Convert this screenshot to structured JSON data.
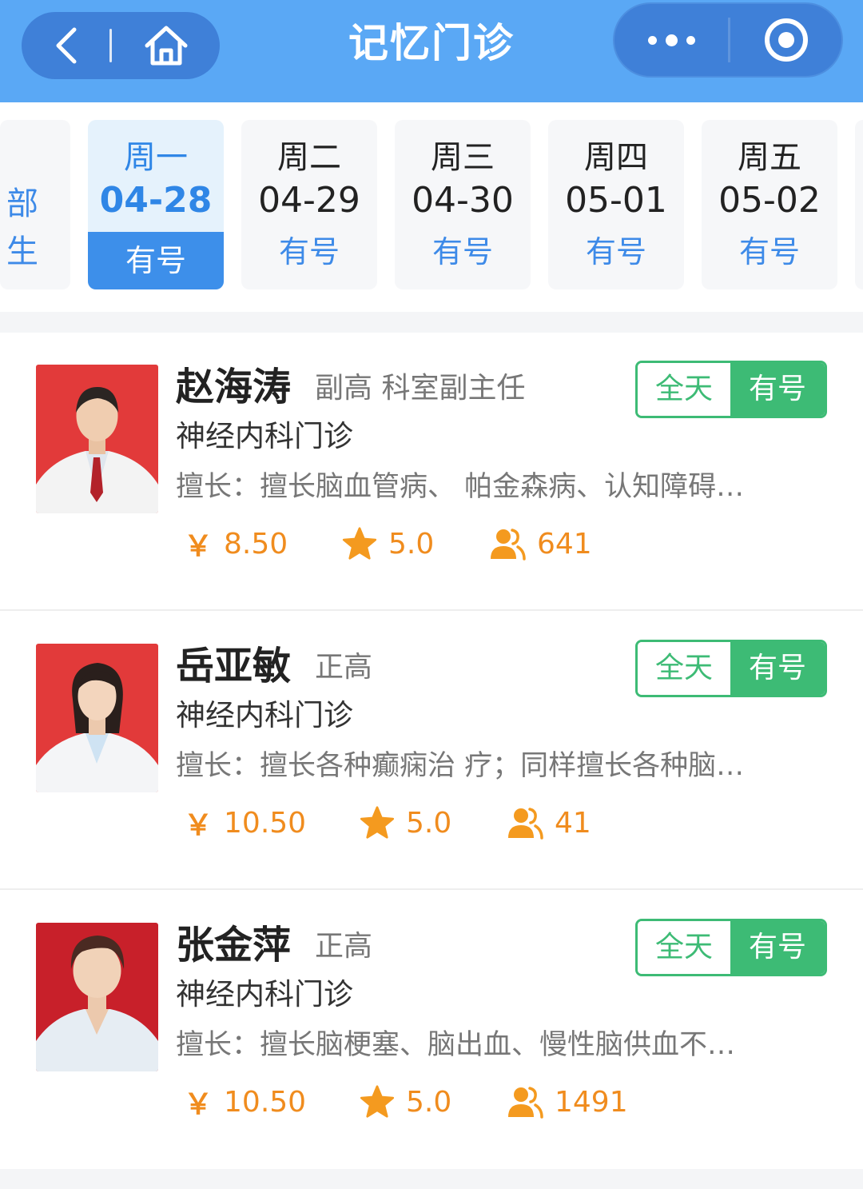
{
  "header": {
    "title": "记忆门诊"
  },
  "date_strip": {
    "partial_left": [
      "部",
      "生"
    ],
    "days": [
      {
        "weekday": "周一",
        "date": "04-28",
        "status": "有号",
        "active": true
      },
      {
        "weekday": "周二",
        "date": "04-29",
        "status": "有号",
        "active": false
      },
      {
        "weekday": "周三",
        "date": "04-30",
        "status": "有号",
        "active": false
      },
      {
        "weekday": "周四",
        "date": "05-01",
        "status": "有号",
        "active": false
      },
      {
        "weekday": "周五",
        "date": "05-02",
        "status": "有号",
        "active": false
      }
    ]
  },
  "doctors": [
    {
      "name": "赵海涛",
      "title": "副高 科室副主任",
      "dept": "神经内科门诊",
      "skill": "擅长：擅长脑血管病、 帕金森病、认知障碍…",
      "badge_period": "全天",
      "badge_status": "有号",
      "price": "8.50",
      "rating": "5.0",
      "count": "641"
    },
    {
      "name": "岳亚敏",
      "title": "正高",
      "dept": "神经内科门诊",
      "skill": "擅长：擅长各种癫痫治 疗；同样擅长各种脑…",
      "badge_period": "全天",
      "badge_status": "有号",
      "price": "10.50",
      "rating": "5.0",
      "count": "41"
    },
    {
      "name": "张金萍",
      "title": "正高",
      "dept": "神经内科门诊",
      "skill": "擅长：擅长脑梗塞、脑出血、慢性脑供血不…",
      "badge_period": "全天",
      "badge_status": "有号",
      "price": "10.50",
      "rating": "5.0",
      "count": "1491"
    }
  ],
  "symbols": {
    "currency": "￥"
  },
  "colors": {
    "header_bg": "#5aa8f5",
    "capsule_bg": "#3f80d8",
    "accent_blue": "#3d8fea",
    "green": "#3dbb75",
    "orange": "#f08c1e"
  },
  "icons": [
    "back-arrow-icon",
    "home-icon",
    "more-dots-icon",
    "close-target-icon",
    "star-icon",
    "users-icon"
  ]
}
